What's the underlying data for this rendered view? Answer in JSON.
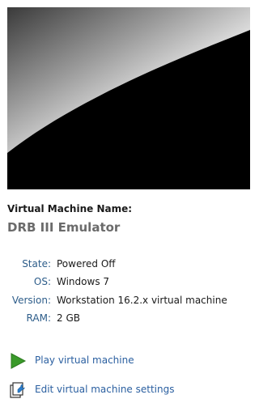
{
  "preview": {
    "colors": {
      "background": "#000000",
      "highlight": "#ffffff"
    }
  },
  "vm": {
    "name_label": "Virtual Machine Name:",
    "name": "DRB III Emulator"
  },
  "details": {
    "state_label": "State:",
    "state_value": "Powered Off",
    "os_label": "OS:",
    "os_value": "Windows 7",
    "version_label": "Version:",
    "version_value": "Workstation 16.2.x virtual machine",
    "ram_label": "RAM:",
    "ram_value": "2 GB"
  },
  "actions": {
    "play_label": "Play virtual machine",
    "play_icon": "play-icon",
    "edit_label": "Edit virtual machine settings",
    "edit_icon": "settings-icon"
  },
  "colors": {
    "detail_key": "#2d5d8a",
    "link": "#2a5fa0",
    "play_green": "#3a9a2a"
  }
}
